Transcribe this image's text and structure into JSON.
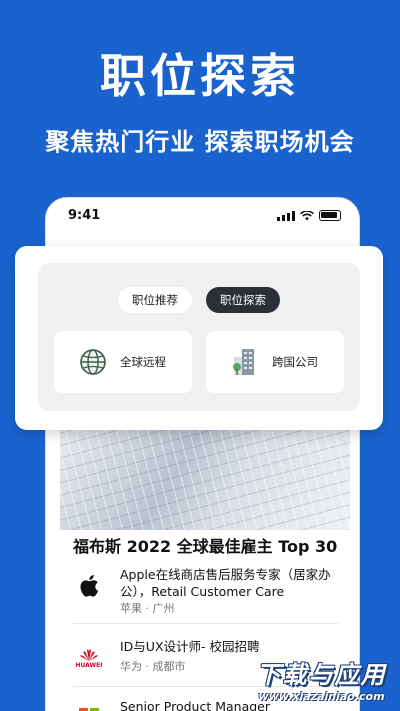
{
  "hero": {
    "title": "职位探索",
    "subtitle": "聚焦热门行业 探索职场机会"
  },
  "status_bar": {
    "time": "9:41"
  },
  "tabs": [
    {
      "label": "职位推荐",
      "active": false
    },
    {
      "label": "职位探索",
      "active": true
    }
  ],
  "options": [
    {
      "label": "全球远程",
      "icon": "globe-icon"
    },
    {
      "label": "跨国公司",
      "icon": "building-icon"
    }
  ],
  "section": {
    "title": "福布斯 2022 全球最佳雇主 Top 30"
  },
  "jobs": [
    {
      "title": "Apple在线商店售后服务专家（居家办公），Retail Customer Care",
      "meta": "苹果 · 广州",
      "logo": "apple-logo"
    },
    {
      "title": "ID与UX设计师- 校园招聘",
      "meta": "华为 · 成都市",
      "logo": "huawei-logo",
      "logo_text": "HUAWEI"
    },
    {
      "title": "Senior Product Manager",
      "meta": "",
      "logo": "microsoft-logo"
    }
  ],
  "watermark": {
    "main": "下载与应用",
    "sub": "www.xiazainiao.com"
  },
  "colors": {
    "background": "#1a63cf",
    "active_pill": "#2b2f36",
    "huawei_red": "#cf0a2c"
  }
}
